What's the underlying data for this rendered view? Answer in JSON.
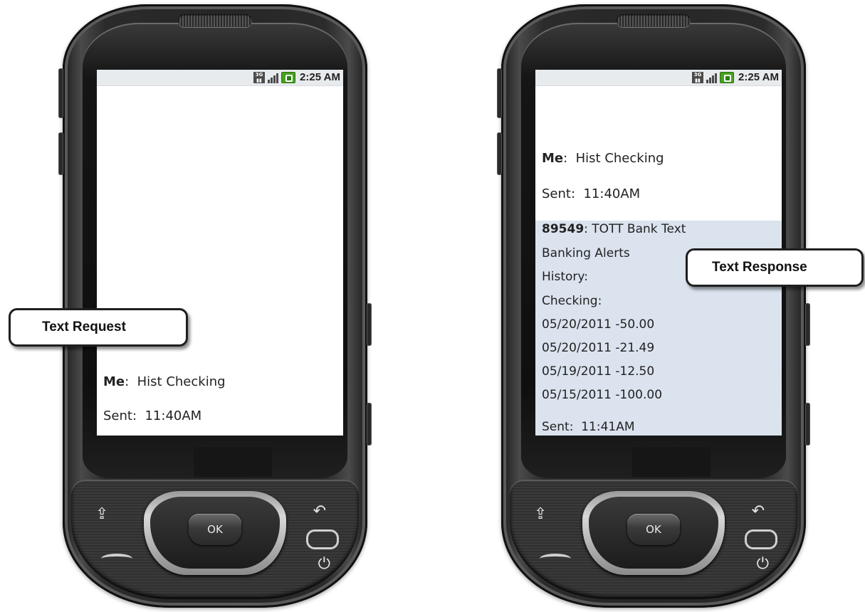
{
  "callouts": {
    "request": "Text Request",
    "response": "Text Response"
  },
  "status_bar": {
    "network": "3G",
    "time": "2:25 AM",
    "icons": [
      "3g-icon",
      "signal-icon",
      "battery-icon"
    ],
    "battery_color": "#46a31f"
  },
  "left_phone": {
    "sender_label": "Me",
    "message": "Hist Checking",
    "sent_label": "Sent:",
    "sent_time": "11:40AM"
  },
  "right_phone": {
    "sender_label": "Me",
    "message": "Hist Checking",
    "sent_label": "Sent:",
    "sent_time": "11:40AM",
    "reply": {
      "sender_number": "89549",
      "lines": [
        "TOTT Bank Text",
        "Banking Alerts",
        "History:",
        "Checking:",
        "05/20/2011 -50.00",
        "05/20/2011 -21.49",
        "05/19/2011 -12.50",
        "05/15/2011 -100.00"
      ],
      "sent_label": "Sent:",
      "sent_time": "11:41AM",
      "background": "#dae3ee"
    }
  },
  "hardware_keys": {
    "ok_label": "OK",
    "icons": [
      "menu-icon",
      "back-icon",
      "home-icon",
      "call-icon",
      "end-call-icon"
    ]
  }
}
